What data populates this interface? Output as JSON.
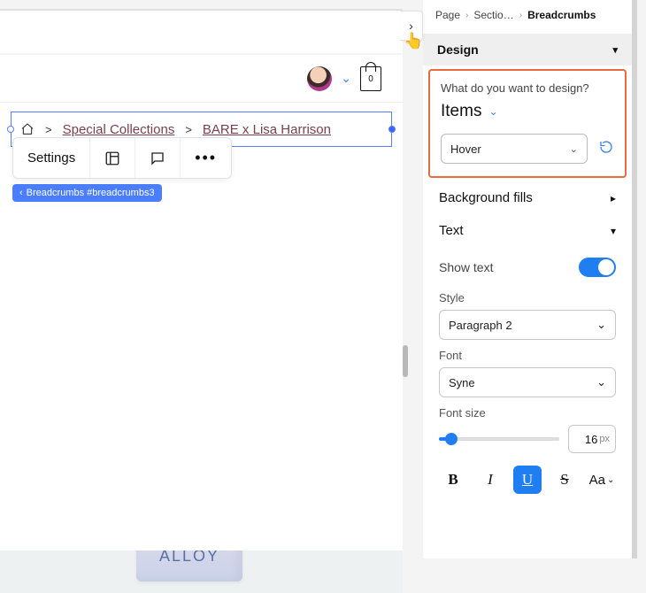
{
  "canvas": {
    "header": {
      "bag_count": "0"
    },
    "breadcrumbs": {
      "item1": "Special Collections",
      "item2": "BARE x Lisa Harrison"
    },
    "toolbar": {
      "settings_label": "Settings"
    },
    "tag": "Breadcrumbs #breadcrumbs3",
    "product_label": "ALLOY"
  },
  "panel": {
    "crumbs": {
      "a": "Page",
      "b": "Sectio…",
      "c": "Breadcrumbs"
    },
    "design_header": "Design",
    "design_question": "What do you want to design?",
    "items_label": "Items",
    "state_select": "Hover",
    "bg_fills": "Background fills",
    "text_header": "Text",
    "show_text": "Show text",
    "style_label": "Style",
    "style_value": "Paragraph 2",
    "font_label": "Font",
    "font_value": "Syne",
    "fontsize_label": "Font size",
    "fontsize_value": "16",
    "fontsize_unit": "px",
    "fmt": {
      "bold": "B",
      "italic": "I",
      "underline": "U",
      "strike": "S",
      "case": "Aa"
    }
  }
}
